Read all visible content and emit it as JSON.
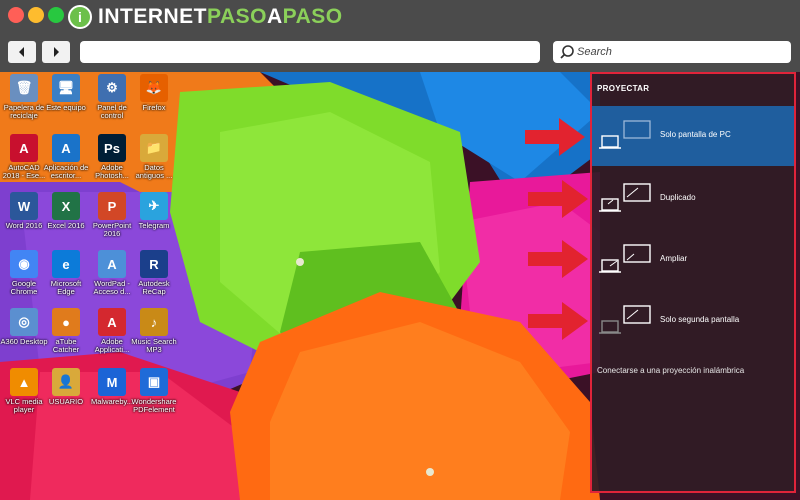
{
  "site": {
    "logo_letter": "i",
    "logo_part1": "INTERNET",
    "logo_part2": "PASO",
    "logo_part3": "A",
    "logo_part4": "PASO"
  },
  "toolbar": {
    "search_placeholder": "Search"
  },
  "desktop_icons": [
    {
      "label": "Papelera de reciclaje",
      "glyph": "🗑",
      "color": "#6a8fbf"
    },
    {
      "label": "Este equipo",
      "glyph": "🖥",
      "color": "#3b7fc4"
    },
    {
      "label": "Panel de control",
      "glyph": "⚙",
      "color": "#3f6fb0"
    },
    {
      "label": "Firefox",
      "glyph": "🦊",
      "color": "#e66000"
    },
    {
      "label": "AutoCAD 2018 - Ese...",
      "glyph": "A",
      "color": "#c8102e"
    },
    {
      "label": "Aplicación de escritor...",
      "glyph": "A",
      "color": "#1a73c9"
    },
    {
      "label": "Adobe Photosh...",
      "glyph": "Ps",
      "color": "#001e36"
    },
    {
      "label": "Datos antiguos ...",
      "glyph": "📁",
      "color": "#d9a93a"
    },
    {
      "label": "Word 2016",
      "glyph": "W",
      "color": "#2b579a"
    },
    {
      "label": "Excel 2016",
      "glyph": "X",
      "color": "#217346"
    },
    {
      "label": "PowerPoint 2016",
      "glyph": "P",
      "color": "#d24726"
    },
    {
      "label": "Telegram",
      "glyph": "✈",
      "color": "#2aa3de"
    },
    {
      "label": "Google Chrome",
      "glyph": "◉",
      "color": "#4285f4"
    },
    {
      "label": "Microsoft Edge",
      "glyph": "e",
      "color": "#0c7bd9"
    },
    {
      "label": "WordPad - Acceso d...",
      "glyph": "A",
      "color": "#4d90d8"
    },
    {
      "label": "Autodesk ReCap",
      "glyph": "R",
      "color": "#1b3f8b"
    },
    {
      "label": "A360 Desktop",
      "glyph": "◎",
      "color": "#5b8fd0"
    },
    {
      "label": "aTube Catcher",
      "glyph": "●",
      "color": "#e07b1c"
    },
    {
      "label": "Adobe Applicati...",
      "glyph": "A",
      "color": "#d4282f"
    },
    {
      "label": "Music Search MP3",
      "glyph": "♪",
      "color": "#c98a17"
    },
    {
      "label": "VLC media player",
      "glyph": "▲",
      "color": "#f08c00"
    },
    {
      "label": "USUARIO",
      "glyph": "👤",
      "color": "#d9a93a"
    },
    {
      "label": "Malwareby...",
      "glyph": "M",
      "color": "#1c64d6"
    },
    {
      "label": "Wondershare PDFelement",
      "glyph": "▣",
      "color": "#1f6bd8"
    }
  ],
  "project_panel": {
    "title": "PROYECTAR",
    "options": [
      {
        "label": "Solo pantalla de PC",
        "selected": true
      },
      {
        "label": "Duplicado",
        "selected": false
      },
      {
        "label": "Ampliar",
        "selected": false
      },
      {
        "label": "Solo segunda pantalla",
        "selected": false
      }
    ],
    "wireless_link": "Conectarse a una proyección inalámbrica"
  },
  "colors": {
    "accent_selected": "#1f5e9e",
    "highlight_border": "#e0243a",
    "arrow": "#e2232f"
  }
}
